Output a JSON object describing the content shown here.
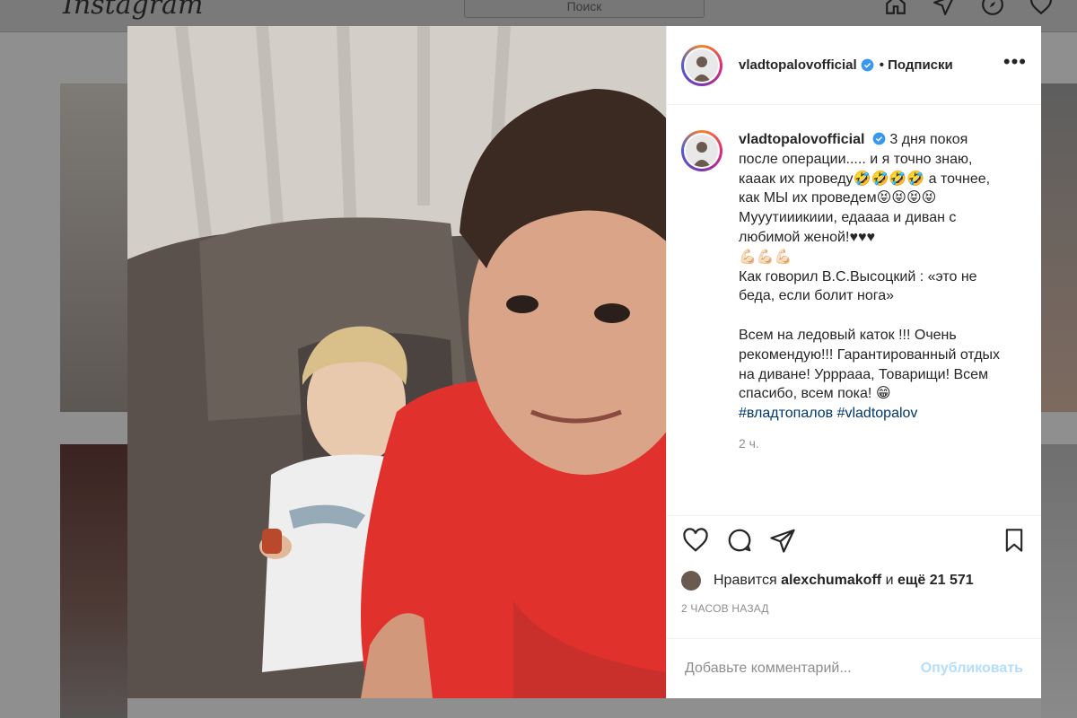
{
  "topbar": {
    "logo": "Instagram",
    "search_placeholder": "Поиск"
  },
  "post": {
    "username": "vladtopalovofficial",
    "follow_label": "• Подписки",
    "more_label": "•••",
    "caption_lines": [
      "3 дня покоя после операции..... и я точно знаю, кааак их проведу🤣🤣🤣🤣 а точнее, как МЫ их проведем😝😝😝😝",
      "Мууутииикиии, едаааа и диван с любимой женой!♥♥♥",
      "💪🏻💪🏻💪🏻",
      "Как говорил В.С.Высоцкий : «это не беда, если болит нога»",
      "",
      "Всем на ледовый каток !!! Очень рекомендую!!! Гарантированный отдых на диване! Урррааа, Товарищи! Всем спасибо, всем пока! 😁"
    ],
    "hashtags": [
      "#владтопалов",
      "#vladtopalov"
    ],
    "caption_time": "2 ч.",
    "likes": {
      "prefix": "Нравится",
      "user": "alexchumakoff",
      "connector": "и",
      "others": "ещё 21 571"
    },
    "date": "2 ЧАСОВ НАЗАД",
    "comment_placeholder": "Добавьте комментарий...",
    "publish_label": "Опубликовать"
  },
  "colors": {
    "link": "#00376b",
    "verified": "#3897f0",
    "publish_disabled": "#b2dffc"
  }
}
